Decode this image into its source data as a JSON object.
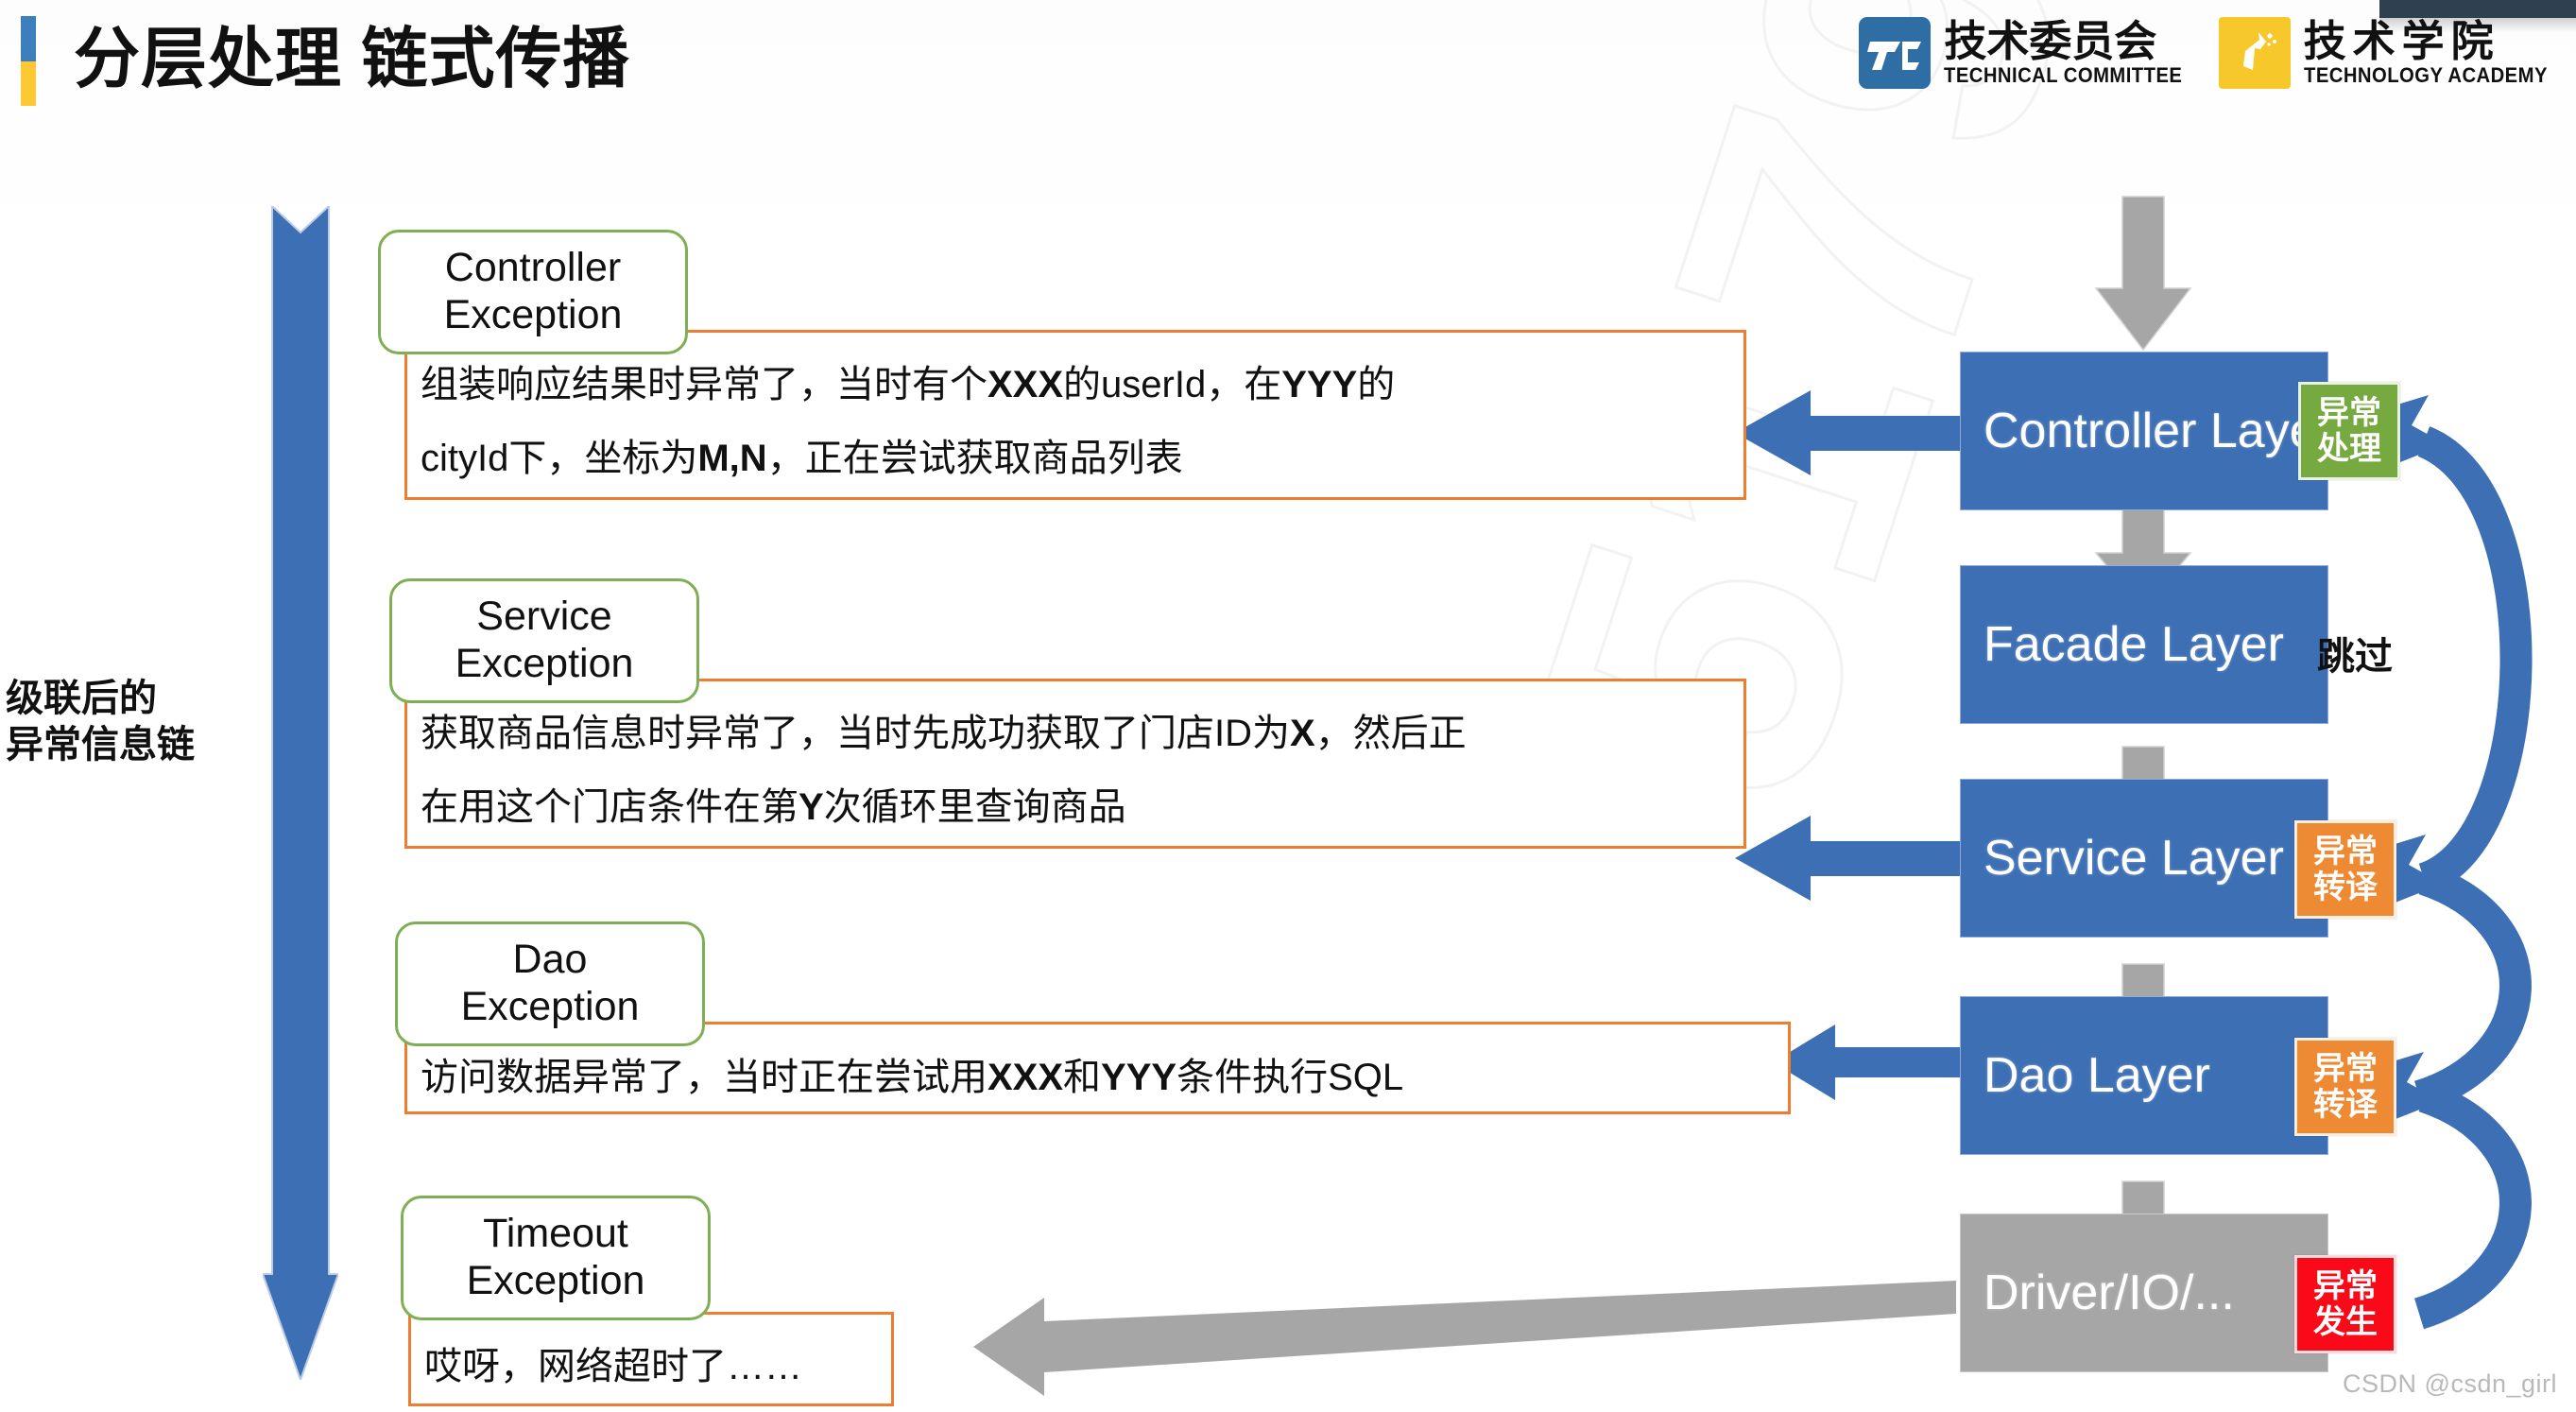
{
  "page": {
    "title": "分层处理 链式传播",
    "accent_blue": "#3d7ebd",
    "accent_yellow": "#fcc932",
    "watermark": "CSDN @csdn_girl"
  },
  "logos": [
    {
      "id": "technical-committee",
      "mark": "TC",
      "cn": "技术委员会",
      "en": "TECHNICAL COMMITTEE",
      "color": "#2f6da5"
    },
    {
      "id": "technology-academy",
      "mark": "",
      "cn": "技术学院",
      "en": "TECHNOLOGY ACADEMY",
      "color": "#f6c82c"
    }
  ],
  "left_caption": {
    "line1": "级联后的",
    "line2": "异常信息链"
  },
  "cards": [
    {
      "tag_line1": "Controller",
      "tag_line2": "Exception",
      "text_line1_a": "组装响应结果时异常了，当时有个",
      "text_line1_b": "XXX",
      "text_line1_c": "的userId，在",
      "text_line1_d": "YYY",
      "text_line1_e": "的",
      "text_line2_a": "cityId下，坐标为",
      "text_line2_b": "M,N",
      "text_line2_c": "，正在尝试获取商品列表"
    },
    {
      "tag_line1": "Service",
      "tag_line2": "Exception",
      "text_line1_a": "获取商品信息时异常了，当时先成功获取了门店ID为",
      "text_line1_b": "X",
      "text_line1_c": "，然后正",
      "text_line2_a": "在用这个门店条件在第",
      "text_line2_b": "Y",
      "text_line2_c": "次循环里查询商品"
    },
    {
      "tag_line1": "Dao",
      "tag_line2": "Exception",
      "text_line1_a": "访问数据异常了，当时正在尝试用",
      "text_line1_b": "XXX",
      "text_line1_c": "和",
      "text_line1_d": "YYY",
      "text_line1_e": "条件执行SQL"
    },
    {
      "tag_line1": "Timeout",
      "tag_line2": "Exception",
      "text_line1_a": "哎呀，网络超时了……"
    }
  ],
  "layers": [
    {
      "name": "Controller Layer",
      "style": "blue",
      "badge": {
        "line1": "异常",
        "line2": "处理",
        "color": "green",
        "hex": "#76a93f"
      }
    },
    {
      "name": "Facade Layer",
      "style": "blue",
      "note": "跳过",
      "badge": null
    },
    {
      "name": "Service Layer",
      "style": "blue",
      "badge": {
        "line1": "异常",
        "line2": "转译",
        "color": "orange",
        "hex": "#ed8a33"
      }
    },
    {
      "name": "Dao Layer",
      "style": "blue",
      "badge": {
        "line1": "异常",
        "line2": "转译",
        "color": "orange",
        "hex": "#ed8a33"
      }
    },
    {
      "name": "Driver/IO/...",
      "style": "gray",
      "badge": {
        "line1": "异常",
        "line2": "发生",
        "color": "red",
        "hex": "#fa0a19"
      }
    }
  ],
  "colors": {
    "card_border": "#ed7d31",
    "tag_border": "#7faf54",
    "layer_blue": "#3d6fb5",
    "layer_gray": "#a6a6a6",
    "flow_arrow": "#a6a6a6",
    "back_arrow": "#3d6fb5",
    "big_arrow": "#3d6fb5"
  }
}
